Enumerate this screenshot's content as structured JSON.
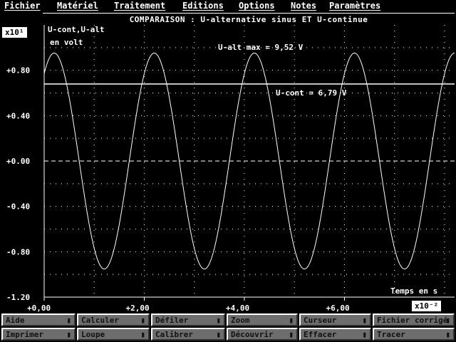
{
  "menu": {
    "items": [
      "Fichier",
      "Matériel",
      "Traitement",
      "Editions",
      "Options",
      "Notes",
      "Paramètres"
    ]
  },
  "window": {
    "title": "COMPARAISON : U-alternative sinus  ET U-continue"
  },
  "axes": {
    "y_exponent": "x10¹",
    "x_exponent": "x10⁻²",
    "y_label_line1": "U-cont,U-alt",
    "y_label_line2": "en volt",
    "x_label": "Temps en s"
  },
  "annotations": {
    "ualt_max": "U-alt max = 9,52 V",
    "ucont": "U-cont = 6,79 V"
  },
  "chart_data": {
    "type": "line",
    "x_tick_labels": [
      "+0,00",
      "+2,00",
      "+4,00",
      "+6,00"
    ],
    "y_tick_labels": [
      "+0.80",
      "+0.40",
      "+0.00",
      "-0.40",
      "-0.80",
      "-1.20"
    ],
    "xlim": [
      0,
      8.2
    ],
    "ylim": [
      -1.2,
      1.2
    ],
    "grid": true,
    "series": [
      {
        "name": "U-alt",
        "kind": "sine",
        "amplitude": 0.952,
        "period": 2.0,
        "peak_at": 0.2,
        "color": "#ffffff"
      },
      {
        "name": "U-cont",
        "kind": "constant",
        "value": 0.679,
        "color": "#ffffff"
      },
      {
        "name": "",
        "kind": "zero-dashed",
        "value": 0.0,
        "color": "#ffffff"
      }
    ]
  },
  "buttons": [
    {
      "label": "Aide"
    },
    {
      "label": "Calculer"
    },
    {
      "label": "Défiler"
    },
    {
      "label": "Zoom"
    },
    {
      "label": "Curseur"
    },
    {
      "label": "Fichier corrigé"
    },
    {
      "label": "Imprimer"
    },
    {
      "label": "Loupe"
    },
    {
      "label": "Calibrer"
    },
    {
      "label": "Découvrir"
    },
    {
      "label": "Effacer"
    },
    {
      "label": "Tracer"
    }
  ]
}
